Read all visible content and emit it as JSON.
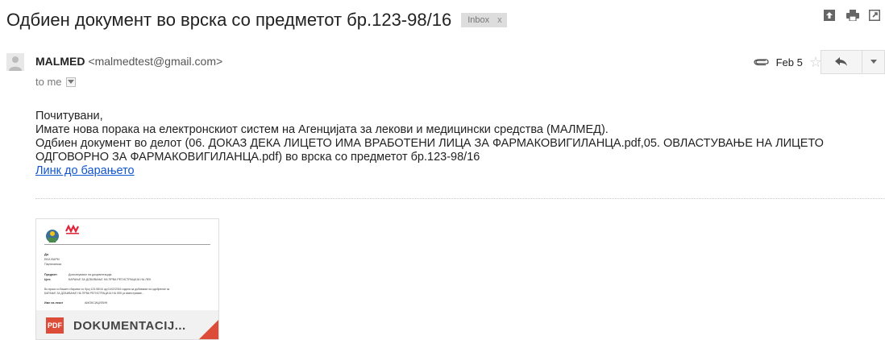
{
  "header": {
    "subject": "Одбиен документ во врска со предметот бр.123-98/16",
    "label": "Inbox",
    "label_remove": "x"
  },
  "toolbar": {
    "icons": [
      "expand-icon",
      "print-icon",
      "new-window-icon"
    ]
  },
  "message": {
    "sender_name": "MALMED",
    "sender_email": "<malmedtest@gmail.com>",
    "to": "to me",
    "date": "Feb 5",
    "body": {
      "greeting": "Почитувани,",
      "line1": "Имате нова порака на електронскиот систем на Агенцијата за лекови и медицински средства (МАЛМЕД).",
      "line2": "Одбиен документ во делот (06. ДОКАЗ ДЕКА ЛИЦЕТО ИМА ВРАБОТЕНИ ЛИЦА ЗА ФАРМАКОВИГИЛАНЦА.pdf,05. ОВЛАСТУВАЊЕ НА ЛИЦЕТО ОДГОВОРНО ЗА ФАРМАКОВИГИЛАНЦА.pdf) во врска со предметот бр.123-98/16",
      "link": "Линк до барањето"
    }
  },
  "attachment": {
    "type_badge": "PDF",
    "name": "DOKUMENTACIJ...",
    "preview": {
      "to_label": "До",
      "recipient_line1": "ЕКИ-ФАРМ",
      "recipient_line2": "Партизанска",
      "subject_label": "Предмет:",
      "subject_value": "Дополнување на документација",
      "purpose_label": "Цел:",
      "purpose_value": "БАРАЊЕ ЗА ДОБИВАЊЕ НА ПРВА РЕГИСТРАЦИЈА НА ЛЕК",
      "paragraph_line1": "Во врска со Вашето барање со број 123-98/16 од 01/02/2016 година за добивање на одобрение за",
      "paragraph_line2": "БАРАЊЕ ЗА ДОБИВАЊЕ НА ПРВА РЕГИСТРАЦИЈА НА ЛЕК ја известуваме...",
      "drug_label": "Име на лекот",
      "drug_value": "АМОКСИЦИЛИН"
    }
  },
  "colors": {
    "link": "#1155cc",
    "pdf_red": "#dd4b39",
    "malmed_red": "#e0243a",
    "chip_bg": "#dddddd"
  }
}
